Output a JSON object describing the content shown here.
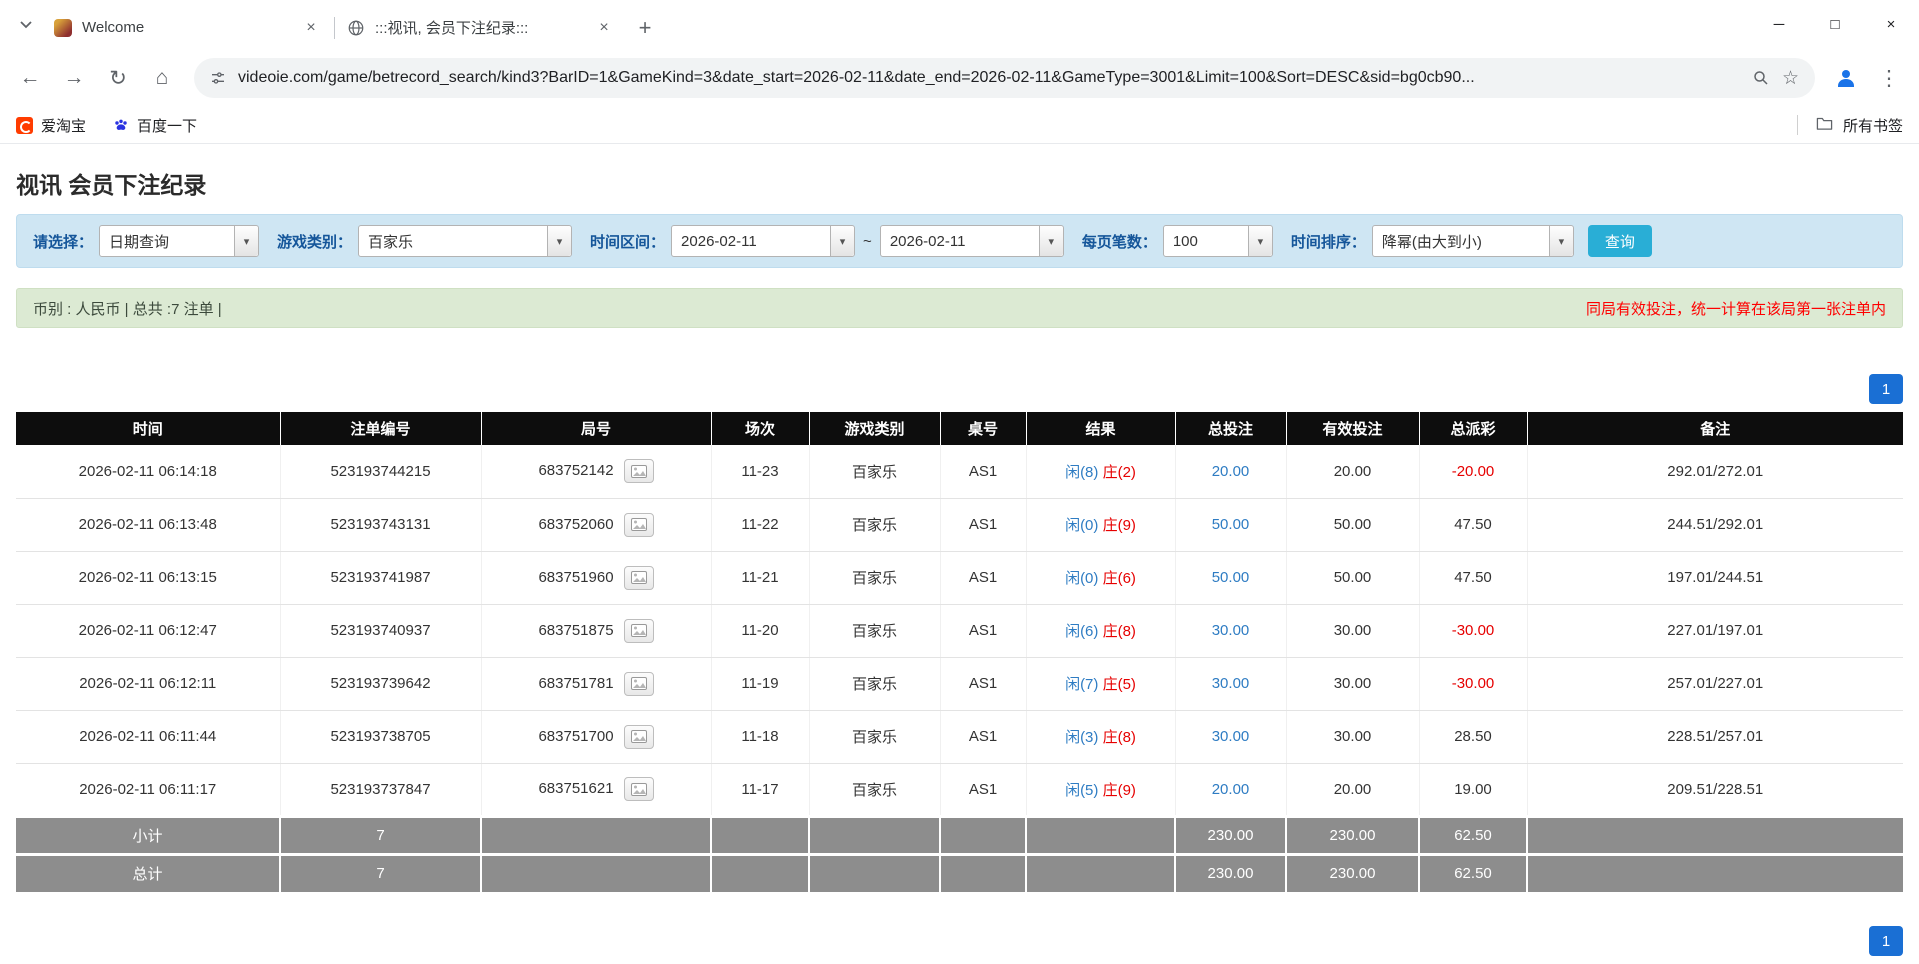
{
  "browser": {
    "tabs": [
      {
        "title": "Welcome"
      },
      {
        "title": ":::视讯, 会员下注纪录:::"
      }
    ],
    "url": "videoie.com/game/betrecord_search/kind3?BarID=1&GameKind=3&date_start=2026-02-11&date_end=2026-02-11&GameType=3001&Limit=100&Sort=DESC&sid=bg0cb90...",
    "bookmarks": [
      {
        "label": "爱淘宝"
      },
      {
        "label": "百度一下"
      }
    ],
    "bookmarks_label": "所有书签"
  },
  "icons": {
    "close": "×",
    "new_tab": "+",
    "minimize": "─",
    "maximize": "□",
    "close_window": "×",
    "back": "←",
    "forward": "→",
    "refresh": "↻",
    "home": "⌂",
    "star": "☆",
    "menu": "⋮",
    "dropdown": "▾"
  },
  "colors": {
    "link_blue": "#2e7cc3",
    "loss_red": "#e60000",
    "search_button": "#29aed6",
    "pager_blue": "#1a6fd4",
    "header_bg": "#0d0d0d",
    "footer_bg": "#8d8d8d",
    "filter_bg": "#cfe6f3",
    "summary_bg": "#dcead3"
  },
  "page": {
    "title": "视讯 会员下注纪录",
    "filters": {
      "select_label": "请选择：",
      "select_value": "日期查询",
      "game_label": "游戏类别：",
      "game_value": "百家乐",
      "date_label": "时间区间：",
      "date_start": "2026-02-11",
      "date_separator": "~",
      "date_end": "2026-02-11",
      "limit_label": "每页笔数：",
      "limit_value": "100",
      "sort_label": "时间排序：",
      "sort_value": "降幂(由大到小)",
      "search_button": "查询"
    },
    "info": {
      "summary": "币别 : 人民币 | 总共 :7 注单 |",
      "notice": "同局有效投注，统一计算在该局第一张注单内"
    },
    "pagination": {
      "page": "1"
    },
    "table": {
      "headers": [
        "时间",
        "注单编号",
        "局号",
        "场次",
        "游戏类别",
        "桌号",
        "结果",
        "总投注",
        "有效投注",
        "总派彩",
        "备注"
      ],
      "rows": [
        {
          "time": "2026-02-11 06:14:18",
          "bet_id": "523193744215",
          "round": "683752142",
          "session": "11-23",
          "game": "百家乐",
          "table": "AS1",
          "result_player": "闲(8)",
          "result_banker": "庄(2)",
          "total_bet": "20.00",
          "valid_bet": "20.00",
          "payout": "-20.00",
          "remark": "292.01/272.01"
        },
        {
          "time": "2026-02-11 06:13:48",
          "bet_id": "523193743131",
          "round": "683752060",
          "session": "11-22",
          "game": "百家乐",
          "table": "AS1",
          "result_player": "闲(0)",
          "result_banker": "庄(9)",
          "total_bet": "50.00",
          "valid_bet": "50.00",
          "payout": "47.50",
          "remark": "244.51/292.01"
        },
        {
          "time": "2026-02-11 06:13:15",
          "bet_id": "523193741987",
          "round": "683751960",
          "session": "11-21",
          "game": "百家乐",
          "table": "AS1",
          "result_player": "闲(0)",
          "result_banker": "庄(6)",
          "total_bet": "50.00",
          "valid_bet": "50.00",
          "payout": "47.50",
          "remark": "197.01/244.51"
        },
        {
          "time": "2026-02-11 06:12:47",
          "bet_id": "523193740937",
          "round": "683751875",
          "session": "11-20",
          "game": "百家乐",
          "table": "AS1",
          "result_player": "闲(6)",
          "result_banker": "庄(8)",
          "total_bet": "30.00",
          "valid_bet": "30.00",
          "payout": "-30.00",
          "remark": "227.01/197.01"
        },
        {
          "time": "2026-02-11 06:12:11",
          "bet_id": "523193739642",
          "round": "683751781",
          "session": "11-19",
          "game": "百家乐",
          "table": "AS1",
          "result_player": "闲(7)",
          "result_banker": "庄(5)",
          "total_bet": "30.00",
          "valid_bet": "30.00",
          "payout": "-30.00",
          "remark": "257.01/227.01"
        },
        {
          "time": "2026-02-11 06:11:44",
          "bet_id": "523193738705",
          "round": "683751700",
          "session": "11-18",
          "game": "百家乐",
          "table": "AS1",
          "result_player": "闲(3)",
          "result_banker": "庄(8)",
          "total_bet": "30.00",
          "valid_bet": "30.00",
          "payout": "28.50",
          "remark": "228.51/257.01"
        },
        {
          "time": "2026-02-11 06:11:17",
          "bet_id": "523193737847",
          "round": "683751621",
          "session": "11-17",
          "game": "百家乐",
          "table": "AS1",
          "result_player": "闲(5)",
          "result_banker": "庄(9)",
          "total_bet": "20.00",
          "valid_bet": "20.00",
          "payout": "19.00",
          "remark": "209.51/228.51"
        }
      ],
      "footer": [
        {
          "label": "小计",
          "count": "7",
          "total_bet": "230.00",
          "valid_bet": "230.00",
          "payout": "62.50"
        },
        {
          "label": "总计",
          "count": "7",
          "total_bet": "230.00",
          "valid_bet": "230.00",
          "payout": "62.50"
        }
      ]
    }
  }
}
